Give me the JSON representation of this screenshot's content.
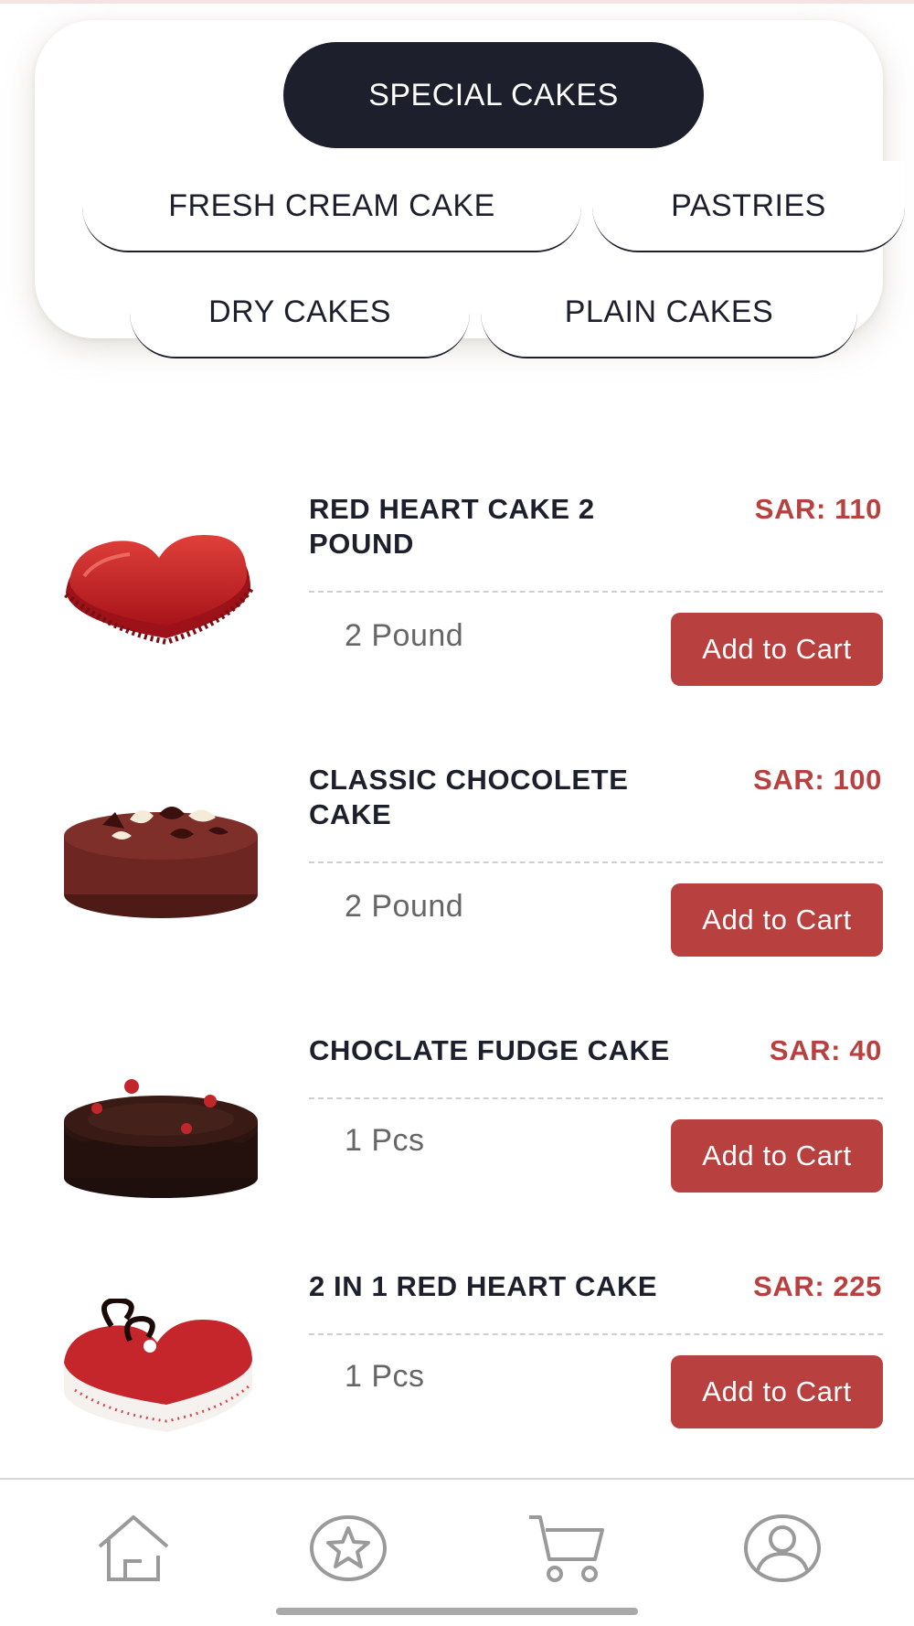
{
  "categories": {
    "special": "SPECIAL CAKES",
    "fresh_cream": "FRESH CREAM CAKE",
    "pastries": "PASTRIES",
    "dry": "DRY CAKES",
    "plain": "PLAIN CAKES",
    "active": "SPECIAL CAKES"
  },
  "products": [
    {
      "name": "RED HEART CAKE 2 POUND",
      "price": "SAR: 110",
      "unit": "2 Pound",
      "cart_label": "Add to Cart",
      "image": "red-heart-cake-image"
    },
    {
      "name": "CLASSIC CHOCOLETE CAKE",
      "price": "SAR: 100",
      "unit": "2 Pound",
      "cart_label": "Add to Cart",
      "image": "chocolate-cake-image"
    },
    {
      "name": "CHOCLATE FUDGE CAKE",
      "price": "SAR: 40",
      "unit": "1 Pcs",
      "cart_label": "Add to Cart",
      "image": "fudge-cake-image"
    },
    {
      "name": "2 IN 1 RED HEART CAKE",
      "price": "SAR: 225",
      "unit": "1 Pcs",
      "cart_label": "Add to Cart",
      "image": "red-velvet-heart-cake-image"
    }
  ],
  "nav": {
    "items": [
      "home-icon",
      "favorites-icon",
      "cart-icon",
      "profile-icon"
    ]
  },
  "colors": {
    "accent": "#b8413f",
    "dark": "#1e1f2c",
    "nav_icon": "#9a9a9a"
  }
}
